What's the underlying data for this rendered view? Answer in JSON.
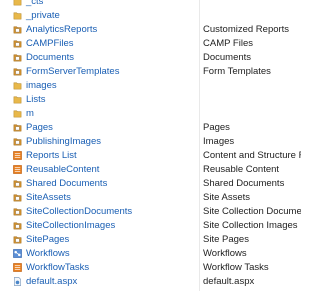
{
  "rows": [
    {
      "name": "_cts",
      "desc": "",
      "icon": "folder-icon",
      "nameColor": "#1a5fb4"
    },
    {
      "name": "_private",
      "desc": "",
      "icon": "folder-icon",
      "nameColor": "#1a5fb4"
    },
    {
      "name": "AnalyticsReports",
      "desc": "Customized Reports",
      "icon": "document-library-icon"
    },
    {
      "name": "CAMPFiles",
      "desc": "CAMP Files",
      "icon": "document-library-icon"
    },
    {
      "name": "Documents",
      "desc": "Documents",
      "icon": "document-library-icon"
    },
    {
      "name": "FormServerTemplates",
      "desc": "Form Templates",
      "icon": "document-library-icon"
    },
    {
      "name": "images",
      "desc": "",
      "icon": "folder-icon"
    },
    {
      "name": "Lists",
      "desc": "",
      "icon": "folder-icon"
    },
    {
      "name": "m",
      "desc": "",
      "icon": "folder-icon"
    },
    {
      "name": "Pages",
      "desc": "Pages",
      "icon": "document-library-icon"
    },
    {
      "name": "PublishingImages",
      "desc": "Images",
      "icon": "document-library-icon"
    },
    {
      "name": "Reports List",
      "desc": "Content and Structure R...",
      "icon": "list-icon"
    },
    {
      "name": "ReusableContent",
      "desc": "Reusable Content",
      "icon": "list-icon"
    },
    {
      "name": "Shared Documents",
      "desc": "Shared Documents",
      "icon": "document-library-icon"
    },
    {
      "name": "SiteAssets",
      "desc": "Site Assets",
      "icon": "document-library-icon"
    },
    {
      "name": "SiteCollectionDocuments",
      "desc": "Site Collection Docume...",
      "icon": "document-library-icon"
    },
    {
      "name": "SiteCollectionImages",
      "desc": "Site Collection Images",
      "icon": "document-library-icon"
    },
    {
      "name": "SitePages",
      "desc": "Site Pages",
      "icon": "document-library-icon"
    },
    {
      "name": "Workflows",
      "desc": "Workflows",
      "icon": "workflow-icon"
    },
    {
      "name": "WorkflowTasks",
      "desc": "Workflow Tasks",
      "icon": "list-icon"
    },
    {
      "name": "default.aspx",
      "desc": "default.aspx",
      "icon": "aspx-file-icon"
    }
  ],
  "colors": {
    "link": "#1a5fb4",
    "folder": "#e8b84a",
    "list": "#e87e1e",
    "library": "#d8962f"
  }
}
